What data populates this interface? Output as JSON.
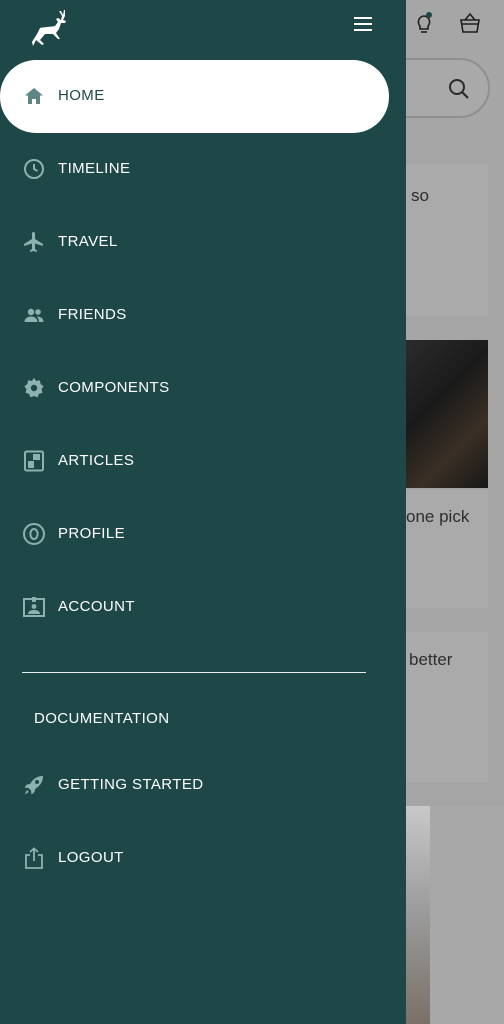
{
  "background": {
    "snippets": [
      "so",
      "one pick",
      "better"
    ]
  },
  "drawer": {
    "logo_icon": "deer-logo-icon",
    "menu_icon": "hamburger-menu-icon",
    "nav": [
      {
        "label": "HOME",
        "icon": "home-icon",
        "active": true
      },
      {
        "label": "TIMELINE",
        "icon": "clock-icon",
        "active": false
      },
      {
        "label": "TRAVEL",
        "icon": "airplane-icon",
        "active": false
      },
      {
        "label": "FRIENDS",
        "icon": "people-icon",
        "active": false
      },
      {
        "label": "COMPONENTS",
        "icon": "gear-icon",
        "active": false
      },
      {
        "label": "ARTICLES",
        "icon": "document-icon",
        "active": false
      },
      {
        "label": "PROFILE",
        "icon": "profile-circle-icon",
        "active": false
      },
      {
        "label": "ACCOUNT",
        "icon": "id-card-icon",
        "active": false
      }
    ],
    "section_title": "DOCUMENTATION",
    "docs": [
      {
        "label": "GETTING STARTED",
        "icon": "rocket-icon"
      },
      {
        "label": "LOGOUT",
        "icon": "share-upload-icon"
      }
    ]
  },
  "colors": {
    "drawer_bg": "#1e4848",
    "active_bg": "#ffffff",
    "icon": "#8fb0b0",
    "active_icon": "#5f8585"
  }
}
